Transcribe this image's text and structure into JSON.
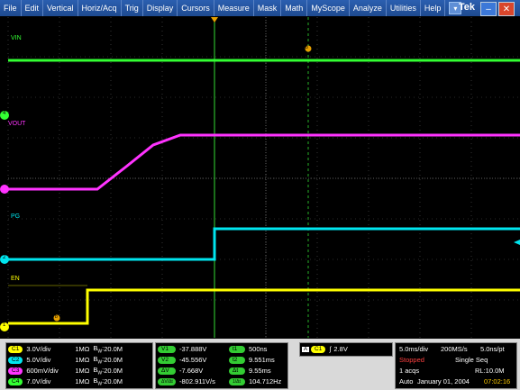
{
  "menu": [
    "File",
    "Edit",
    "Vertical",
    "Horiz/Acq",
    "Trig",
    "Display",
    "Cursors",
    "Measure",
    "Mask",
    "Math",
    "MyScope",
    "Analyze",
    "Utilities",
    "Help"
  ],
  "brand": "Tek",
  "channels": {
    "vin_label": "VIN",
    "vout_label": "VOUT",
    "pg_label": "PG",
    "en_label": "EN",
    "cursor_b_label": "b",
    "marker_1": "1",
    "marker_2": "2",
    "marker_4": "4"
  },
  "colors": {
    "ch1": "#ffff00",
    "ch2": "#00e5ee",
    "ch3": "#ff33ff",
    "ch4": "#33ff33"
  },
  "scales": [
    {
      "ch": "C1",
      "div": "3.0V/div",
      "imp": "1MΩ",
      "bw": "20.0M"
    },
    {
      "ch": "C2",
      "div": "5.0V/div",
      "imp": "1MΩ",
      "bw": "20.0M"
    },
    {
      "ch": "C3",
      "div": "600mV/div",
      "imp": "1MΩ",
      "bw": "20.0M"
    },
    {
      "ch": "C4",
      "div": "7.0V/div",
      "imp": "1MΩ",
      "bw": "20.0M"
    }
  ],
  "cursors": [
    {
      "tag": "V1",
      "val": "-37.888V",
      "tag2": "t1",
      "val2": "500ns"
    },
    {
      "tag": "V2",
      "val": "-45.556V",
      "tag2": "t2",
      "val2": "9.551ms"
    },
    {
      "tag": "ΔV",
      "val": "-7.668V",
      "tag2": "Δt",
      "val2": "9.55ms"
    },
    {
      "tag": "ΔV/Δt",
      "val": "-802.911V/s",
      "tag2": "1/Δt",
      "val2": "104.712Hz"
    }
  ],
  "trigger": {
    "tag": "A",
    "ch": "C1",
    "level": "2.8V"
  },
  "acq": {
    "hdiv": "5.0ms/div",
    "rate": "200MS/s",
    "res": "5.0ns/pt",
    "state": "Stopped",
    "mode": "Single Seq",
    "acqs": "1 acqs",
    "rl": "RL:10.0M",
    "trig_mode": "Auto",
    "date": "January 01, 2004",
    "time": "07:02:16"
  }
}
